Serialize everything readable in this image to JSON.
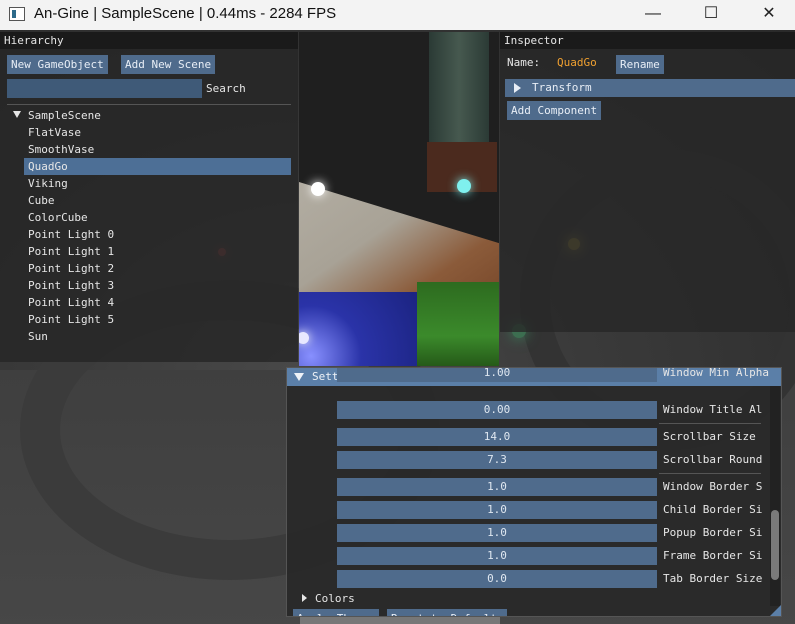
{
  "window": {
    "title": "An-Gine | SampleScene | 0.44ms - 2284 FPS",
    "minimize": "—",
    "maximize": "☐",
    "close": "✕"
  },
  "hierarchy": {
    "title": "Hierarchy",
    "new_gameobject": "New GameObject",
    "add_new_scene": "Add New Scene",
    "search_placeholder": "",
    "search_label": "Search",
    "scene_name": "SampleScene",
    "items": [
      {
        "label": "FlatVase",
        "selected": false
      },
      {
        "label": "SmoothVase",
        "selected": false
      },
      {
        "label": "QuadGo",
        "selected": true
      },
      {
        "label": "Viking",
        "selected": false
      },
      {
        "label": "Cube",
        "selected": false
      },
      {
        "label": "ColorCube",
        "selected": false
      },
      {
        "label": "Point Light 0",
        "selected": false
      },
      {
        "label": "Point Light 1",
        "selected": false
      },
      {
        "label": "Point Light 2",
        "selected": false
      },
      {
        "label": "Point Light 3",
        "selected": false
      },
      {
        "label": "Point Light 4",
        "selected": false
      },
      {
        "label": "Point Light 5",
        "selected": false
      },
      {
        "label": "Sun",
        "selected": false
      }
    ]
  },
  "inspector": {
    "title": "Inspector",
    "name_label": "Name:",
    "name_value": "QuadGo",
    "rename": "Rename",
    "transform": "Transform",
    "add_component": "Add Component"
  },
  "settings": {
    "title": "Settings",
    "rows": [
      {
        "value": "1.00",
        "label": "Window Min Alpha"
      },
      {
        "value": "0.00",
        "label": "Window Title Al"
      },
      {
        "value": "14.0",
        "label": "Scrollbar Size"
      },
      {
        "value": "7.3",
        "label": "Scrollbar Round"
      },
      {
        "value": "1.0",
        "label": "Window Border S"
      },
      {
        "value": "1.0",
        "label": "Child Border Si"
      },
      {
        "value": "1.0",
        "label": "Popup Border Si"
      },
      {
        "value": "1.0",
        "label": "Frame Border Si"
      },
      {
        "value": "0.0",
        "label": "Tab Border Size"
      }
    ],
    "colors": "Colors",
    "bottom_btn_1": "Apply Theme",
    "bottom_btn_2": "Reset to Default"
  },
  "colors": {
    "accent": "#4f6b8c",
    "selected": "#4d6f96",
    "name_value": "#f0a030"
  }
}
